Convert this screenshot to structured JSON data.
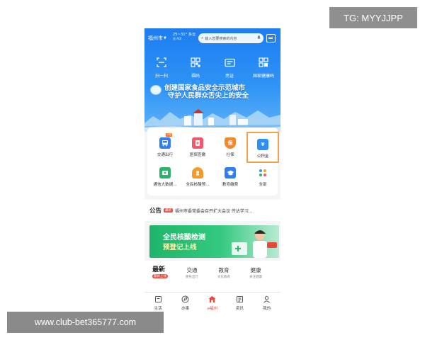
{
  "overlays": {
    "tg_label": "TG: MYYJJPP",
    "url_label": "www.club-bet365777.com"
  },
  "header": {
    "city": "福州市",
    "weather_temp": "25~31° 多云",
    "weather_sub": "良 AQI",
    "search_placeholder": "输入您要搜索的内容"
  },
  "quick_actions": [
    {
      "label": "扫一扫",
      "icon": "scan-icon"
    },
    {
      "label": "福码",
      "icon": "qr-code-icon"
    },
    {
      "label": "亮证",
      "icon": "id-card-icon"
    },
    {
      "label": "国家健康码",
      "icon": "health-code-icon"
    }
  ],
  "banner": {
    "line1": "创建国家食品安全示范城市",
    "line2": "守护人民群众舌尖上的安全"
  },
  "services": [
    {
      "label": "交通出行",
      "icon": "bus-icon",
      "color": "#2f7ff0",
      "tag": "补贴"
    },
    {
      "label": "医保查缴",
      "icon": "medical-insurance-icon",
      "color": "#ef5a6e"
    },
    {
      "label": "社保",
      "icon": "shield-icon",
      "color": "#f28a2a",
      "glyph": "保"
    },
    {
      "label": "公积金",
      "icon": "housing-fund-icon",
      "color": "#2f8ef5",
      "glyph": "¥"
    },
    {
      "label": "通信大数据...",
      "icon": "telecom-icon",
      "color": "#2eb36a"
    },
    {
      "label": "全民核酸预...",
      "icon": "nucleic-test-icon",
      "color": "#f29a2a"
    },
    {
      "label": "教育缴费",
      "icon": "graduation-cap-icon",
      "color": "#2f7ff0"
    },
    {
      "label": "全部",
      "icon": "all-services-icon",
      "color": "#6b6b6b"
    }
  ],
  "notice": {
    "title": "公告",
    "badge": "最新",
    "text": "福州市委常委会召开扩大会议 传达学习..."
  },
  "promo": {
    "line1": "全民核酸检测",
    "line2": "预登记上线"
  },
  "news": {
    "current": "最新",
    "current_badge": "最新上线",
    "tabs": [
      {
        "label": "交通",
        "sub": "便民出行"
      },
      {
        "label": "教育",
        "sub": "文化教育"
      },
      {
        "label": "健康",
        "sub": "关注健康"
      }
    ]
  },
  "tabbar": [
    {
      "label": "生活",
      "icon": "life-icon",
      "active": false
    },
    {
      "label": "办事",
      "icon": "compass-icon",
      "active": false
    },
    {
      "label": "e福州",
      "icon": "home-icon",
      "active": true
    },
    {
      "label": "资讯",
      "icon": "news-icon",
      "active": false
    },
    {
      "label": "我的",
      "icon": "profile-icon",
      "active": false
    }
  ],
  "colors": {
    "primary_blue": "#1d7df0",
    "accent_red": "#e8493b",
    "highlight_orange": "#f0a14a",
    "promo_green": "#1fb56b"
  }
}
